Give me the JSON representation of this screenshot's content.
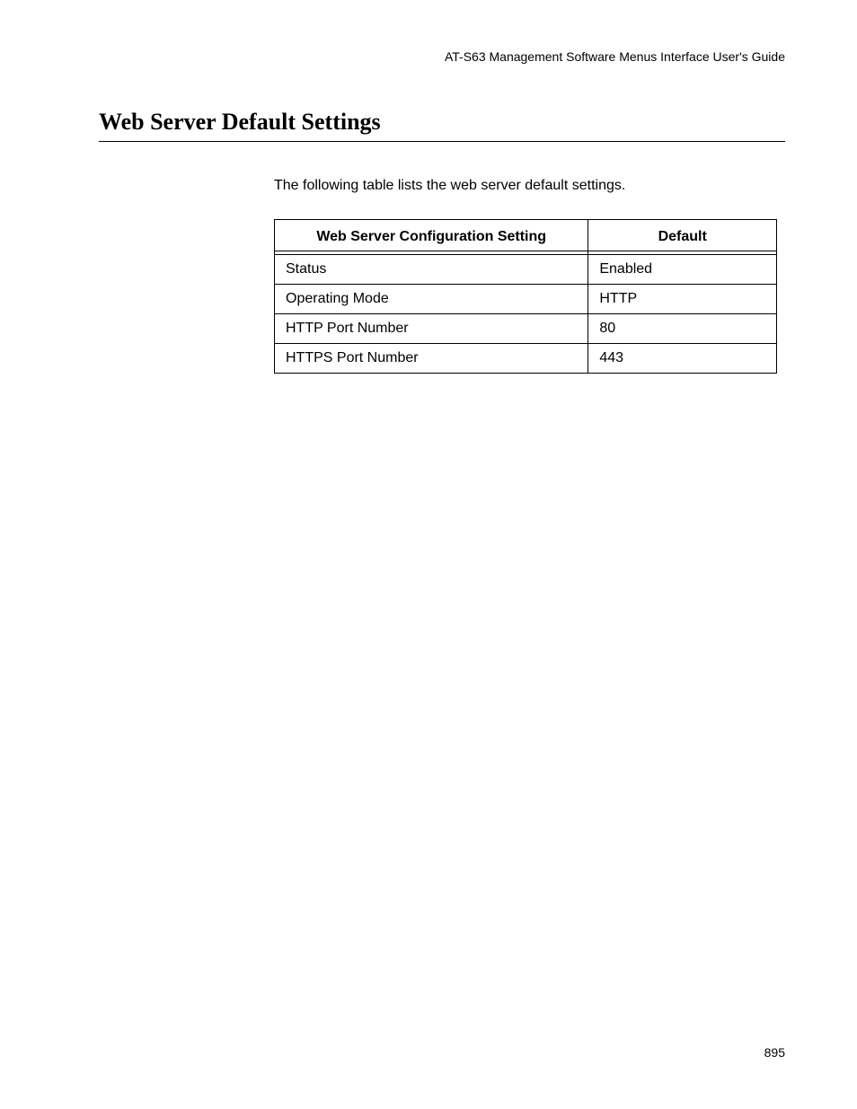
{
  "header": {
    "guide_title": "AT-S63 Management Software Menus Interface User's Guide"
  },
  "section": {
    "title": "Web Server Default Settings",
    "intro": "The following table lists the web server default settings."
  },
  "table": {
    "headers": {
      "setting": "Web Server Configuration Setting",
      "default": "Default"
    },
    "rows": [
      {
        "setting": "Status",
        "default": "Enabled"
      },
      {
        "setting": "Operating Mode",
        "default": "HTTP"
      },
      {
        "setting": "HTTP Port Number",
        "default": "80"
      },
      {
        "setting": "HTTPS Port Number",
        "default": "443"
      }
    ]
  },
  "footer": {
    "page_number": "895"
  }
}
